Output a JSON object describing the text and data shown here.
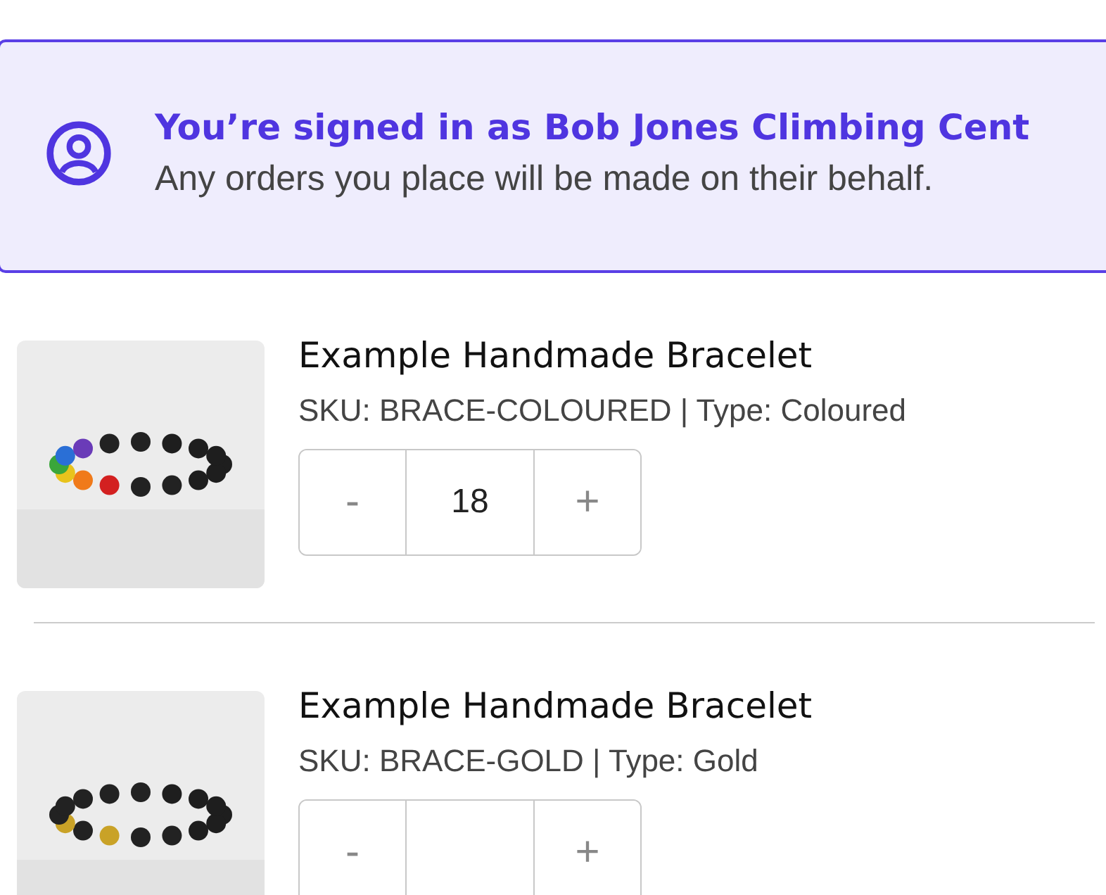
{
  "banner": {
    "title": "You’re signed in as Bob Jones Climbing Cent",
    "message": "Any orders you place will be made on their behalf."
  },
  "products": [
    {
      "name": "Example Handmade Bracelet",
      "details": "SKU: BRACE-COLOURED | Type: Coloured",
      "stepper": {
        "minus": "-",
        "value": "18",
        "plus": "+"
      }
    },
    {
      "name": "Example Handmade Bracelet",
      "details": "SKU: BRACE-GOLD | Type: Gold",
      "stepper": {
        "minus": "-",
        "plus": "+"
      }
    }
  ]
}
